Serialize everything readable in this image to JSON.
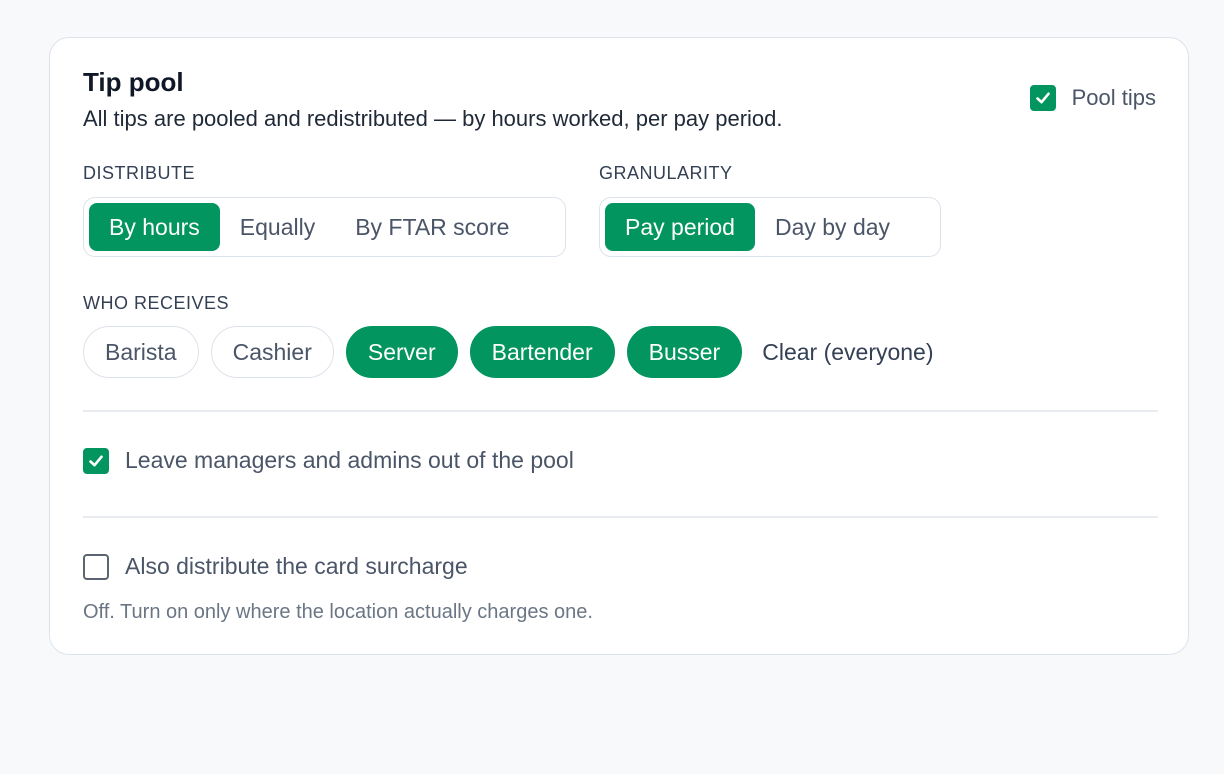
{
  "card": {
    "title": "Tip pool",
    "subtitle": "All tips are pooled and redistributed — by hours worked, per pay period.",
    "pool_toggle": {
      "label": "Pool tips",
      "checked": true
    }
  },
  "distribute": {
    "label": "DISTRIBUTE",
    "options": [
      {
        "label": "By hours",
        "active": true
      },
      {
        "label": "Equally",
        "active": false
      },
      {
        "label": "By FTAR score",
        "active": false
      }
    ]
  },
  "granularity": {
    "label": "GRANULARITY",
    "options": [
      {
        "label": "Pay period",
        "active": true
      },
      {
        "label": "Day by day",
        "active": false
      }
    ]
  },
  "who_receives": {
    "label": "WHO RECEIVES",
    "roles": [
      {
        "label": "Barista",
        "selected": false
      },
      {
        "label": "Cashier",
        "selected": false
      },
      {
        "label": "Server",
        "selected": true
      },
      {
        "label": "Bartender",
        "selected": true
      },
      {
        "label": "Busser",
        "selected": true
      }
    ],
    "clear_label": "Clear (everyone)"
  },
  "exclude_managers": {
    "label": "Leave managers and admins out of the pool",
    "checked": true
  },
  "card_surcharge": {
    "label": "Also distribute the card surcharge",
    "checked": false,
    "helper": "Off. Turn on only where the location actually charges one."
  },
  "colors": {
    "accent": "#03955f",
    "background": "#f8f9fb",
    "border": "#dde3ec"
  }
}
